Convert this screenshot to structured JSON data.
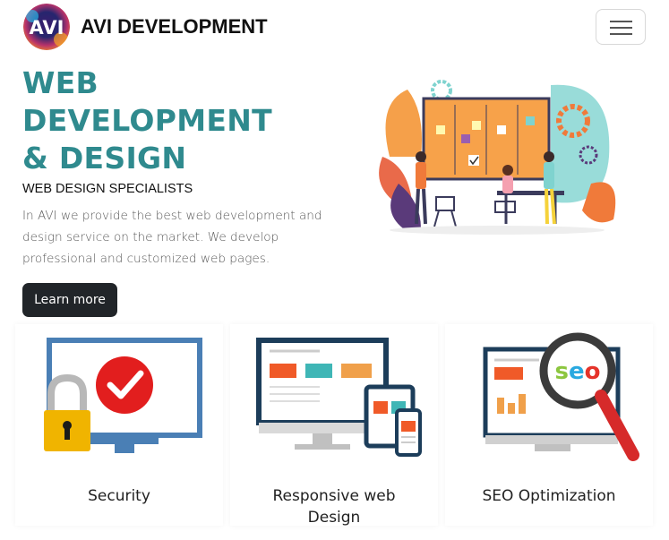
{
  "navbar": {
    "brand": "AVI DEVELOPMENT",
    "logo_letters": "AVI",
    "toggler_icon": "hamburger-icon"
  },
  "hero": {
    "title_line1": "WEB",
    "title_line2": "DEVELOPMENT",
    "title_line3": "& DESIGN",
    "subtitle": "WEB DESIGN SPECIALISTS",
    "description": "In AVI we provide the best web development and design service on the market. We develop professional and customized web pages.",
    "button_label": "Learn more",
    "title_color": "#2f8a8e",
    "illustration_icon": "team-kanban-illustration"
  },
  "cards": [
    {
      "label": "Security",
      "icon": "security-lock-monitor-icon"
    },
    {
      "label": "Responsive web Design",
      "icon": "responsive-devices-icon"
    },
    {
      "label": "SEO Optimization",
      "icon": "seo-magnifier-icon"
    }
  ]
}
